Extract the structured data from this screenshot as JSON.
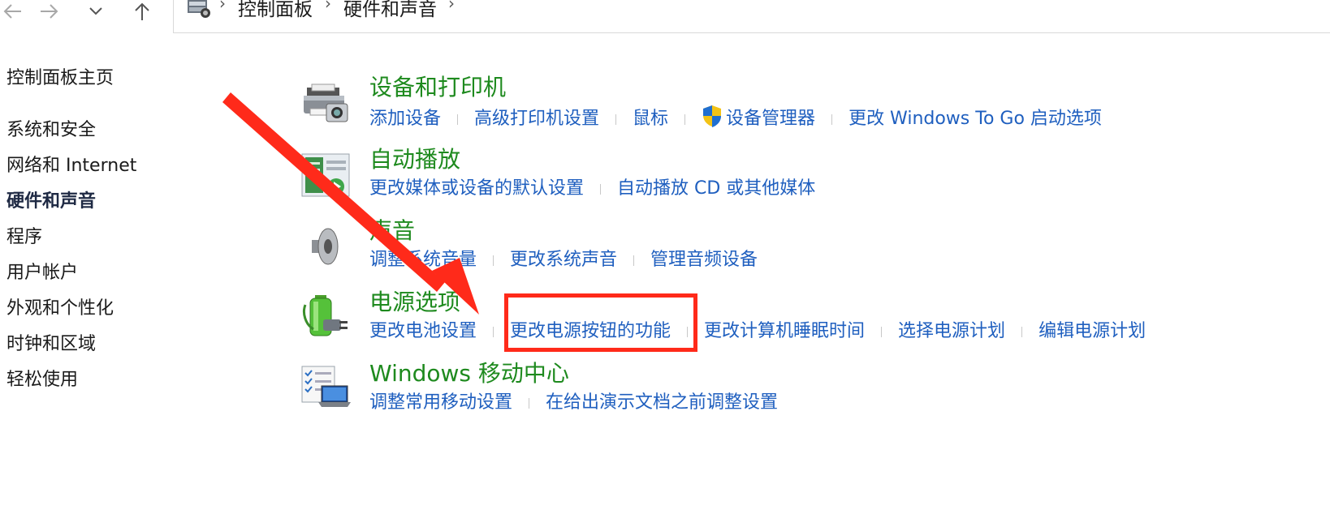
{
  "nav": {
    "back_icon": "arrow-left-icon",
    "forward_icon": "arrow-right-icon",
    "recent_icon": "chevron-down-icon",
    "up_icon": "arrow-up-icon"
  },
  "breadcrumb": {
    "icon": "control-panel-icon",
    "items": [
      "控制面板",
      "硬件和声音"
    ]
  },
  "sidebar": {
    "items": [
      {
        "label": "控制面板主页"
      },
      {
        "label": "系统和安全"
      },
      {
        "label": "网络和 Internet"
      },
      {
        "label": "硬件和声音",
        "current": true
      },
      {
        "label": "程序"
      },
      {
        "label": "用户帐户"
      },
      {
        "label": "外观和个性化"
      },
      {
        "label": "时钟和区域"
      },
      {
        "label": "轻松使用"
      }
    ]
  },
  "categories": [
    {
      "icon": "printer-camera-icon",
      "title": "设备和打印机",
      "links": [
        "添加设备",
        "高级打印机设置",
        "鼠标",
        "设备管理器",
        "更改 Windows To Go 启动选项"
      ]
    },
    {
      "icon": "autoplay-icon",
      "title": "自动播放",
      "links": [
        "更改媒体或设备的默认设置",
        "自动播放 CD 或其他媒体"
      ]
    },
    {
      "icon": "speaker-icon",
      "title": "声音",
      "links": [
        "调整系统音量",
        "更改系统声音",
        "管理音频设备"
      ]
    },
    {
      "icon": "battery-plug-icon",
      "title": "电源选项",
      "links": [
        "更改电池设置",
        "更改电源按钮的功能",
        "更改计算机睡眠时间",
        "选择电源计划",
        "编辑电源计划"
      ]
    },
    {
      "icon": "mobility-center-icon",
      "title": "Windows 移动中心",
      "links": [
        "调整常用移动设置",
        "在给出演示文档之前调整设置"
      ]
    }
  ],
  "annotation": {
    "color": "#ff2a1a",
    "highlighted_link": "更改电源按钮的功能"
  },
  "colors": {
    "category_title": "#1e8a1e",
    "link": "#1f5fbf"
  }
}
